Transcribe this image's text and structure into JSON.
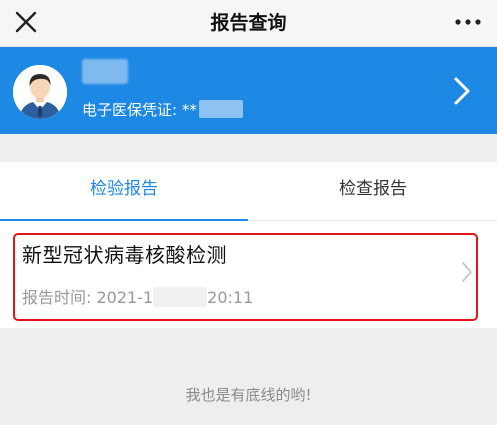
{
  "navbar": {
    "title": "报告查询",
    "close_icon": "close-icon",
    "more_icon": "more-icon"
  },
  "card": {
    "credential_label": "电子医保凭证: **",
    "avatar_icon": "avatar-icon",
    "chevron_icon": "chevron-right-icon",
    "background_color": "#1e88e5"
  },
  "tabs": [
    {
      "label": "检验报告",
      "active": true
    },
    {
      "label": "检查报告",
      "active": false
    }
  ],
  "report": {
    "title": "新型冠状病毒核酸检测",
    "time_prefix": "报告时间: 2021-1",
    "time_suffix": "20:11",
    "highlight_color": "#e1141b",
    "chevron_icon": "chevron-right-icon"
  },
  "footer": {
    "text": "我也是有底线的哟!"
  }
}
